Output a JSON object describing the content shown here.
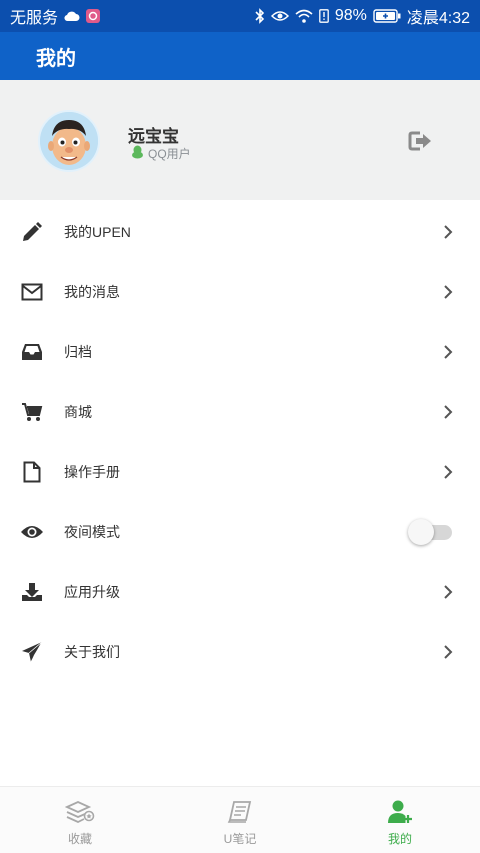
{
  "statusbar": {
    "carrier": "无服务",
    "battery": "98%",
    "time": "凌晨4:32"
  },
  "appbar": {
    "title": "我的"
  },
  "profile": {
    "name": "远宝宝",
    "account_type": "QQ用户"
  },
  "menu": {
    "items": [
      {
        "label": "我的UPEN",
        "icon": "pencil-icon"
      },
      {
        "label": "我的消息",
        "icon": "envelope-icon"
      },
      {
        "label": "归档",
        "icon": "inbox-icon"
      },
      {
        "label": "商城",
        "icon": "cart-icon"
      },
      {
        "label": "操作手册",
        "icon": "document-icon"
      },
      {
        "label": "夜间模式",
        "icon": "eye-icon",
        "toggle": false
      },
      {
        "label": "应用升级",
        "icon": "download-icon"
      },
      {
        "label": "关于我们",
        "icon": "paper-plane-icon"
      }
    ]
  },
  "tabbar": {
    "tabs": [
      {
        "label": "收藏",
        "icon": "stack-icon",
        "active": false
      },
      {
        "label": "U笔记",
        "icon": "notebook-icon",
        "active": false
      },
      {
        "label": "我的",
        "icon": "user-add-icon",
        "active": true
      }
    ]
  },
  "colors": {
    "statusbar": "#0c4fae",
    "appbar": "#0f62c8",
    "active_tab": "#3dac4b",
    "qq_green": "#5cb85c"
  }
}
